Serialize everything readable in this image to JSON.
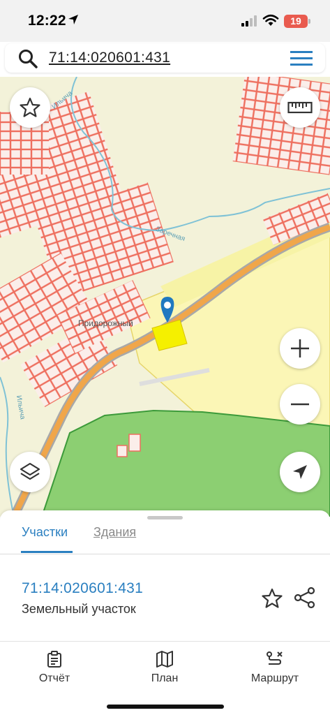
{
  "status_bar": {
    "time": "12:22",
    "battery": "19"
  },
  "search": {
    "query": "71:14:020601:431"
  },
  "map": {
    "place_label": "Придорожный",
    "road_label_1": "Ильича",
    "road_label_2": "Заречная",
    "road_label_3": "Ильича"
  },
  "tabs": [
    {
      "label": "Участки",
      "active": true
    },
    {
      "label": "Здания",
      "active": false
    }
  ],
  "result": {
    "cadastral_number": "71:14:020601:431",
    "type": "Земельный участок"
  },
  "bottom_nav": [
    {
      "label": "Отчёт",
      "icon": "clipboard-icon"
    },
    {
      "label": "План",
      "icon": "map-icon"
    },
    {
      "label": "Маршрут",
      "icon": "route-icon"
    }
  ],
  "colors": {
    "accent": "#2a7fc0",
    "parcel_border": "#ee6f5f",
    "selected_parcel": "#f5f000",
    "forest": "#8ccf72",
    "road": "#f0a64a"
  }
}
